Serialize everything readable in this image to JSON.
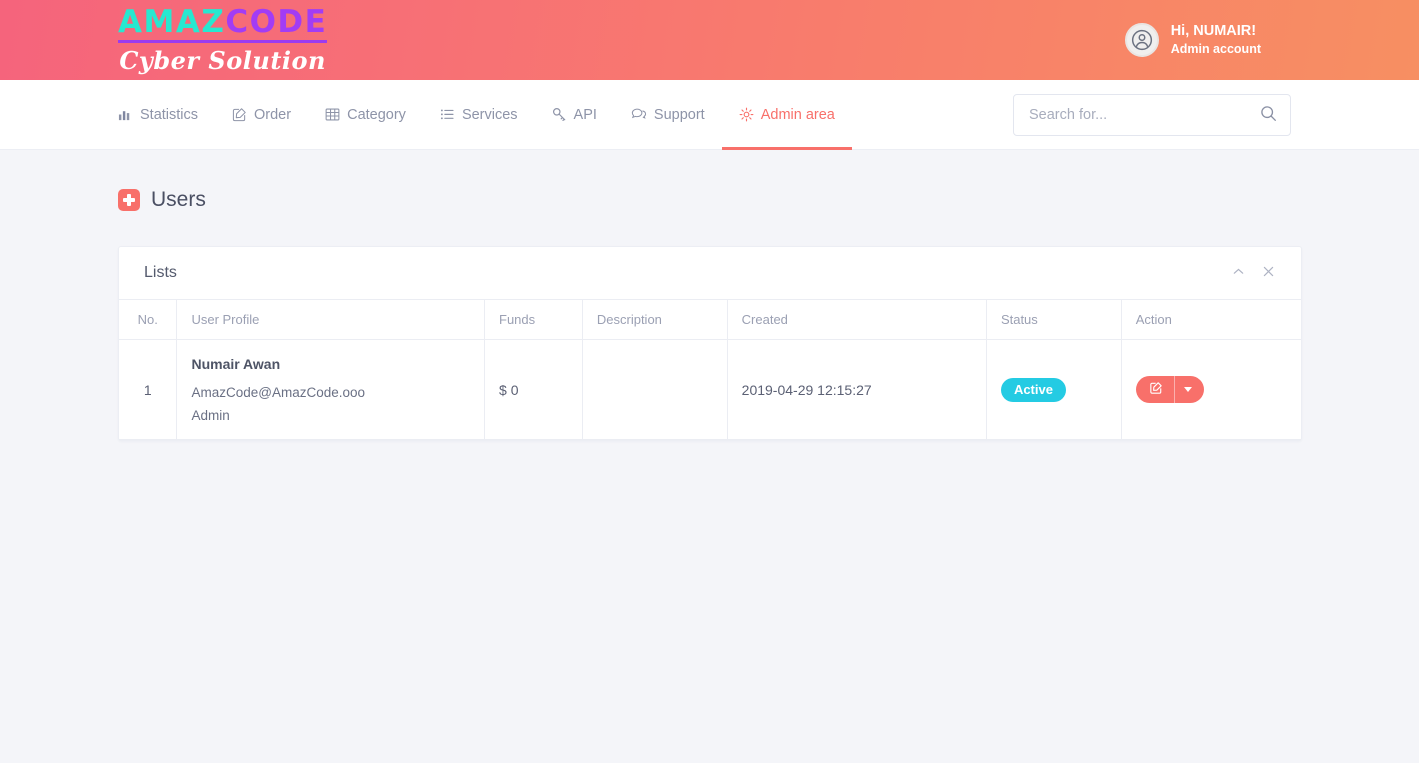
{
  "brand": {
    "logo_primary": "AMAZ",
    "logo_secondary": "CODE",
    "logo_tagline": "Cyber Solution",
    "colors": {
      "logo_primary": "#27e8d0",
      "logo_secondary": "#a23cf5",
      "header_gradient_start": "#f5647c",
      "header_gradient_end": "#f78f62",
      "accent": "#f8706a",
      "status_active": "#24cbe3",
      "page_background": "#f4f5f9"
    }
  },
  "account": {
    "greeting": "Hi, NUMAIR!",
    "role": "Admin account",
    "avatar_icon": "user-circle-icon"
  },
  "nav": {
    "items": [
      {
        "label": "Statistics",
        "icon": "bar-chart-icon",
        "active": false
      },
      {
        "label": "Order",
        "icon": "edit-square-icon",
        "active": false
      },
      {
        "label": "Category",
        "icon": "table-grid-icon",
        "active": false
      },
      {
        "label": "Services",
        "icon": "list-icon",
        "active": false
      },
      {
        "label": "API",
        "icon": "key-icon",
        "active": false
      },
      {
        "label": "Support",
        "icon": "chat-bubble-icon",
        "active": false
      },
      {
        "label": "Admin area",
        "icon": "gear-icon",
        "active": true
      }
    ]
  },
  "search": {
    "value": "",
    "placeholder": "Search for...",
    "icon": "search-icon"
  },
  "page": {
    "title": "Users",
    "title_icon": "plus-square-icon"
  },
  "card": {
    "title": "Lists",
    "collapse_icon": "chevron-up-icon",
    "close_icon": "close-icon"
  },
  "table": {
    "columns": [
      "No.",
      "User Profile",
      "Funds",
      "Description",
      "Created",
      "Status",
      "Action"
    ],
    "rows": [
      {
        "no": "1",
        "name": "Numair Awan",
        "email": "AmazCode@AmazCode.ooo",
        "role": "Admin",
        "funds": "$ 0",
        "description": "",
        "created": "2019-04-29 12:15:27",
        "status": "Active",
        "action_edit_icon": "edit-square-icon",
        "action_caret_icon": "caret-down-icon"
      }
    ]
  }
}
